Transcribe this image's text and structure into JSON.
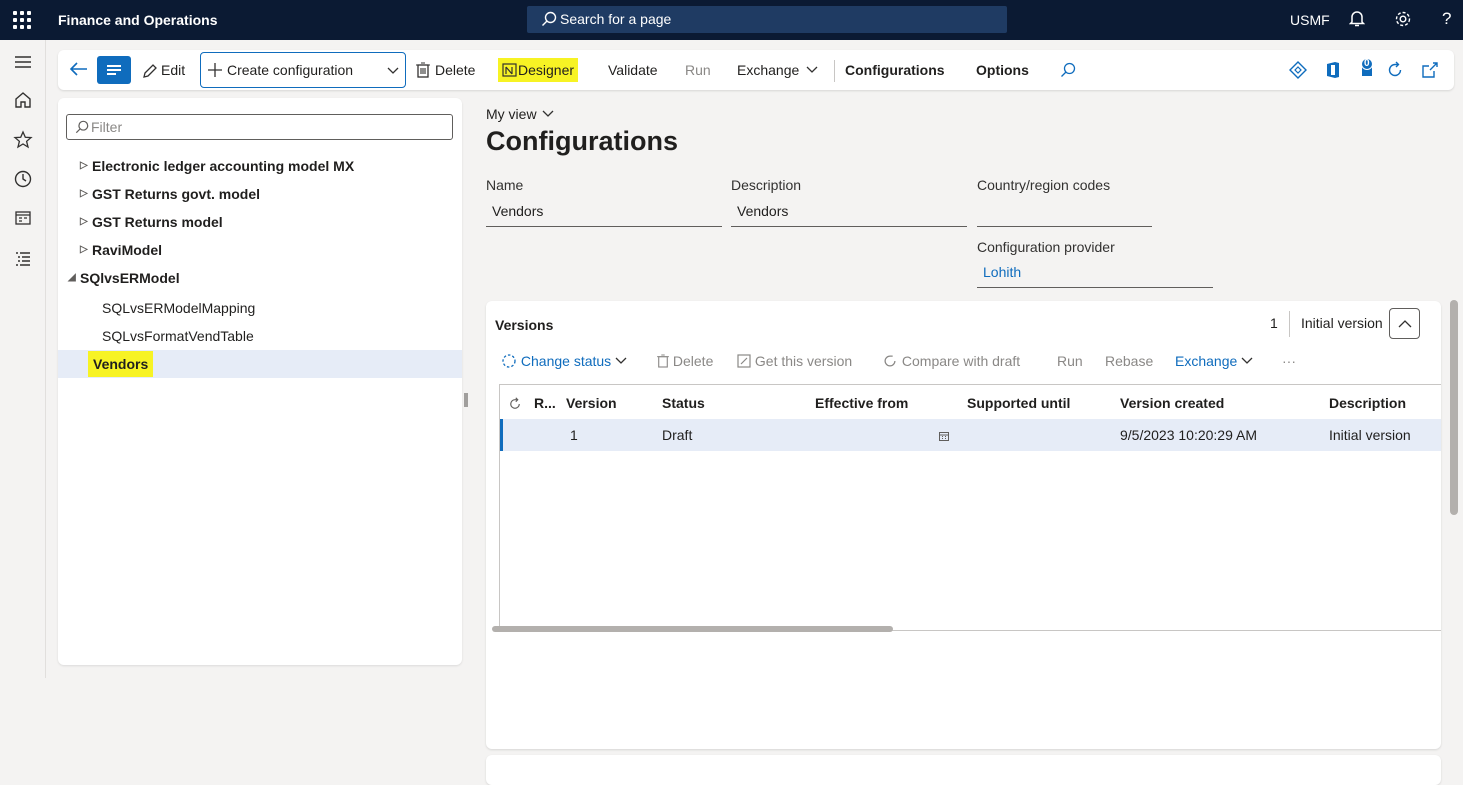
{
  "topbar": {
    "app_name": "Finance and Operations",
    "search_placeholder": "Search for a page",
    "company": "USMF",
    "help": "?"
  },
  "action_pane": {
    "edit": "Edit",
    "create_configuration": "Create configuration",
    "delete": "Delete",
    "designer": "Designer",
    "validate": "Validate",
    "run": "Run",
    "exchange": "Exchange",
    "configurations": "Configurations",
    "options": "Options",
    "notification_count": "0"
  },
  "tree": {
    "filter_placeholder": "Filter",
    "items": [
      {
        "label": "Electronic ledger accounting model MX",
        "arrow": "▷"
      },
      {
        "label": "GST Returns govt. model",
        "arrow": "▷"
      },
      {
        "label": "GST Returns model",
        "arrow": "▷"
      },
      {
        "label": "RaviModel",
        "arrow": "▷"
      },
      {
        "label": "SQlvsERModel",
        "arrow": "◢"
      },
      {
        "label": "SQLvsERModelMapping",
        "arrow": ""
      },
      {
        "label": "SQLvsFormatVendTable",
        "arrow": ""
      },
      {
        "label": "Vendors",
        "arrow": ""
      }
    ]
  },
  "main": {
    "my_view": "My view",
    "title": "Configurations",
    "name_label": "Name",
    "name_value": "Vendors",
    "description_label": "Description",
    "description_value": "Vendors",
    "country_label": "Country/region codes",
    "country_value": "",
    "provider_label": "Configuration provider",
    "provider_value": "Lohith"
  },
  "versions": {
    "title": "Versions",
    "count": "1",
    "summary": "Initial version",
    "toolbar": {
      "change_status": "Change status",
      "delete": "Delete",
      "get_this_version": "Get this version",
      "compare_with_draft": "Compare with draft",
      "run": "Run",
      "rebase": "Rebase",
      "exchange": "Exchange",
      "more": "···"
    },
    "columns": [
      "R...",
      "Version",
      "Status",
      "Effective from",
      "Supported until",
      "Version created",
      "Description"
    ],
    "rows": [
      {
        "version": "1",
        "status": "Draft",
        "effective_from": "",
        "supported_until": "",
        "version_created": "9/5/2023 10:20:29 AM",
        "description": "Initial version"
      }
    ]
  },
  "colors": {
    "topbar": "#0b1a33",
    "accent": "#0f6cbd",
    "highlight": "#f7f324",
    "selected_row": "#e6ecf7"
  }
}
